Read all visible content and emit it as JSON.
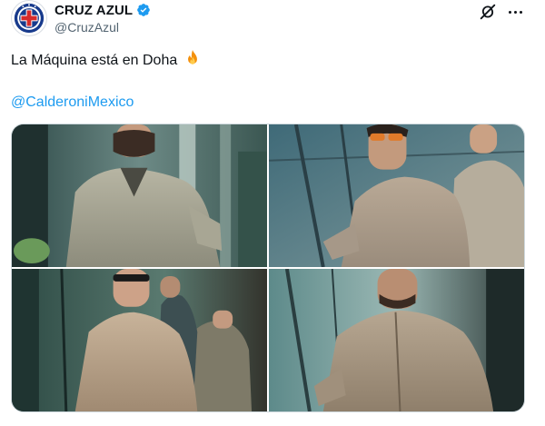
{
  "account": {
    "display_name": "CRUZ AZUL",
    "handle": "@CruzAzul",
    "verified": true,
    "avatar_icon": "cruz-azul-crest"
  },
  "header_actions": {
    "grok_icon": "grok-icon",
    "more_icon": "more-options-icon"
  },
  "tweet": {
    "text": "La Máquina está en Doha",
    "emoji": "fire-icon",
    "mention": "@CalderoniMexico"
  },
  "media": {
    "count": 4,
    "photos": [
      {
        "name": "photo-1",
        "description_icon": "photo"
      },
      {
        "name": "photo-2",
        "description_icon": "photo"
      },
      {
        "name": "photo-3",
        "description_icon": "photo"
      },
      {
        "name": "photo-4",
        "description_icon": "photo"
      }
    ]
  },
  "colors": {
    "link": "#1d9bf0",
    "text": "#0f1419",
    "secondary_text": "#536471",
    "verified_badge": "#1d9bf0",
    "brand_blue": "#173a8c"
  }
}
